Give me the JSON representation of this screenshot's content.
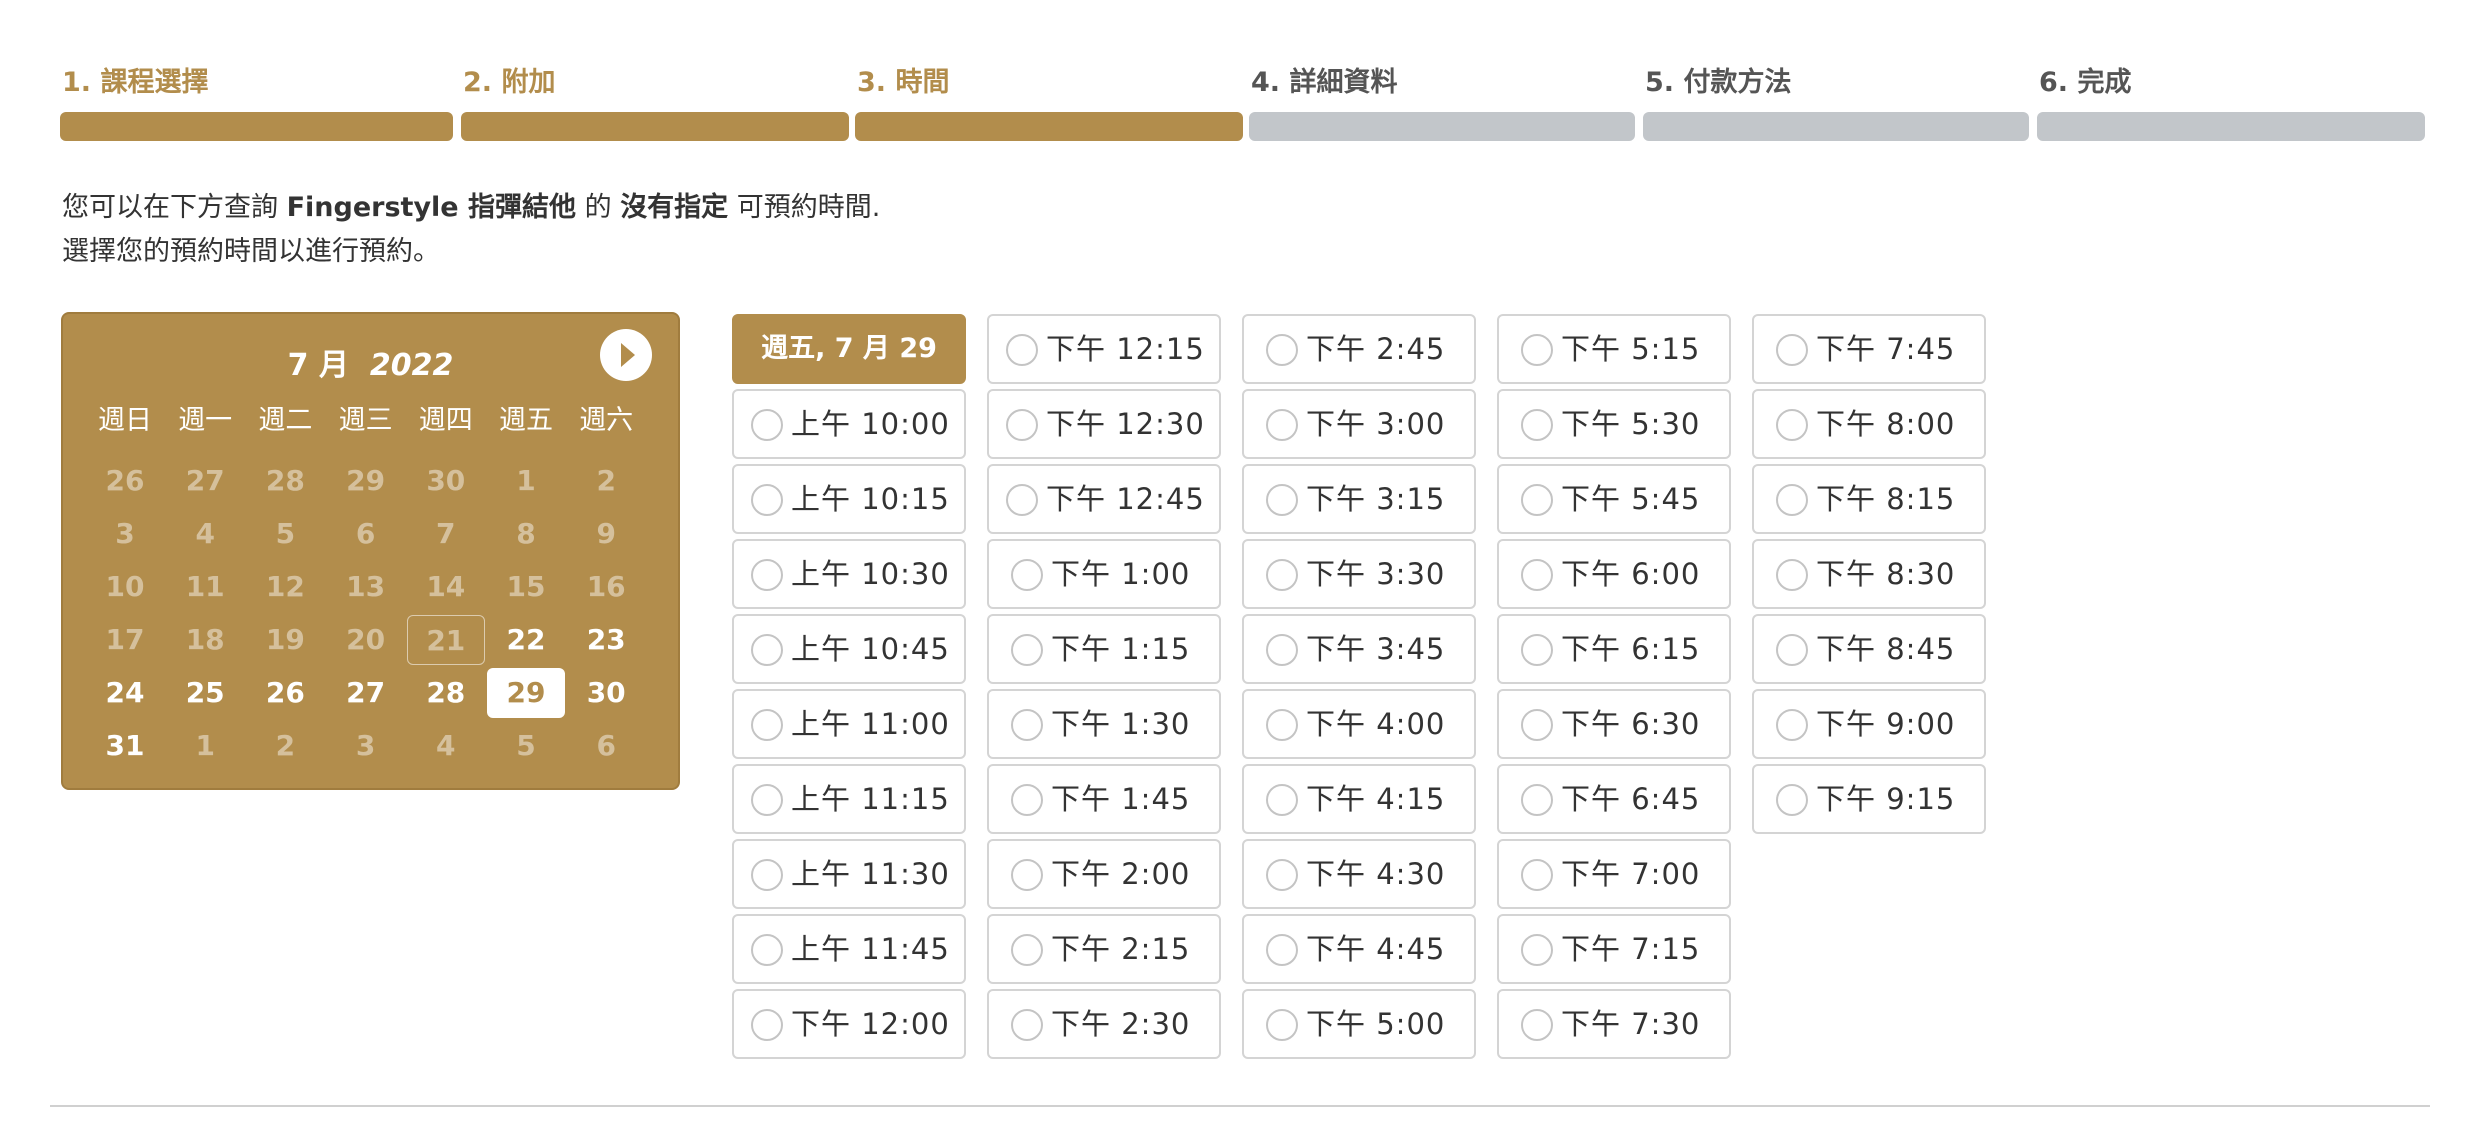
{
  "steps": [
    {
      "label": "1. 課程選擇",
      "state": "done"
    },
    {
      "label": "2. 附加",
      "state": "done"
    },
    {
      "label": "3. 時間",
      "state": "current"
    },
    {
      "label": "4. 詳細資料",
      "state": "todo"
    },
    {
      "label": "5. 付款方法",
      "state": "todo"
    },
    {
      "label": "6. 完成",
      "state": "todo"
    }
  ],
  "intro": {
    "line1_a": "您可以在下方查詢 ",
    "course": "Fingerstyle 指彈結他",
    "line1_b": " 的 ",
    "teacher": "沒有指定",
    "line1_c": " 可預約時間.",
    "line2": "選擇您的預約時間以進行預約。"
  },
  "calendar": {
    "month": "7 月",
    "year": "2022",
    "next_icon": "chevron-right-circle-icon",
    "weekdays": [
      "週日",
      "週一",
      "週二",
      "週三",
      "週四",
      "週五",
      "週六"
    ],
    "weeks": [
      [
        {
          "d": "26",
          "s": "muted"
        },
        {
          "d": "27",
          "s": "muted"
        },
        {
          "d": "28",
          "s": "muted"
        },
        {
          "d": "29",
          "s": "muted"
        },
        {
          "d": "30",
          "s": "muted"
        },
        {
          "d": "1",
          "s": "muted"
        },
        {
          "d": "2",
          "s": "muted"
        }
      ],
      [
        {
          "d": "3",
          "s": "muted"
        },
        {
          "d": "4",
          "s": "muted"
        },
        {
          "d": "5",
          "s": "muted"
        },
        {
          "d": "6",
          "s": "muted"
        },
        {
          "d": "7",
          "s": "muted"
        },
        {
          "d": "8",
          "s": "muted"
        },
        {
          "d": "9",
          "s": "muted"
        }
      ],
      [
        {
          "d": "10",
          "s": "muted"
        },
        {
          "d": "11",
          "s": "muted"
        },
        {
          "d": "12",
          "s": "muted"
        },
        {
          "d": "13",
          "s": "muted"
        },
        {
          "d": "14",
          "s": "muted"
        },
        {
          "d": "15",
          "s": "muted"
        },
        {
          "d": "16",
          "s": "muted"
        }
      ],
      [
        {
          "d": "17",
          "s": "muted"
        },
        {
          "d": "18",
          "s": "muted"
        },
        {
          "d": "19",
          "s": "muted"
        },
        {
          "d": "20",
          "s": "muted"
        },
        {
          "d": "21",
          "s": "today"
        },
        {
          "d": "22",
          "s": "available"
        },
        {
          "d": "23",
          "s": "available"
        }
      ],
      [
        {
          "d": "24",
          "s": "available"
        },
        {
          "d": "25",
          "s": "available"
        },
        {
          "d": "26",
          "s": "available"
        },
        {
          "d": "27",
          "s": "available"
        },
        {
          "d": "28",
          "s": "available"
        },
        {
          "d": "29",
          "s": "selected"
        },
        {
          "d": "30",
          "s": "available"
        }
      ],
      [
        {
          "d": "31",
          "s": "available"
        },
        {
          "d": "1",
          "s": "muted"
        },
        {
          "d": "2",
          "s": "muted"
        },
        {
          "d": "3",
          "s": "muted"
        },
        {
          "d": "4",
          "s": "muted"
        },
        {
          "d": "5",
          "s": "muted"
        },
        {
          "d": "6",
          "s": "muted"
        }
      ]
    ]
  },
  "selected_date_label": "週五, 7 月 29",
  "time_columns": [
    [
      "上午 10:00",
      "上午 10:15",
      "上午 10:30",
      "上午 10:45",
      "上午 11:00",
      "上午 11:15",
      "上午 11:30",
      "上午 11:45",
      "下午 12:00"
    ],
    [
      "下午 12:15",
      "下午 12:30",
      "下午 12:45",
      "下午 1:00",
      "下午 1:15",
      "下午 1:30",
      "下午 1:45",
      "下午 2:00",
      "下午 2:15",
      "下午 2:30"
    ],
    [
      "下午 2:45",
      "下午 3:00",
      "下午 3:15",
      "下午 3:30",
      "下午 3:45",
      "下午 4:00",
      "下午 4:15",
      "下午 4:30",
      "下午 4:45",
      "下午 5:00"
    ],
    [
      "下午 5:15",
      "下午 5:30",
      "下午 5:45",
      "下午 6:00",
      "下午 6:15",
      "下午 6:30",
      "下午 6:45",
      "下午 7:00",
      "下午 7:15",
      "下午 7:30"
    ],
    [
      "下午 7:45",
      "下午 8:00",
      "下午 8:15",
      "下午 8:30",
      "下午 8:45",
      "下午 9:00",
      "下午 9:15"
    ]
  ],
  "colors": {
    "accent": "#b28d4c",
    "inactive_bar": "#c2c6ca"
  }
}
